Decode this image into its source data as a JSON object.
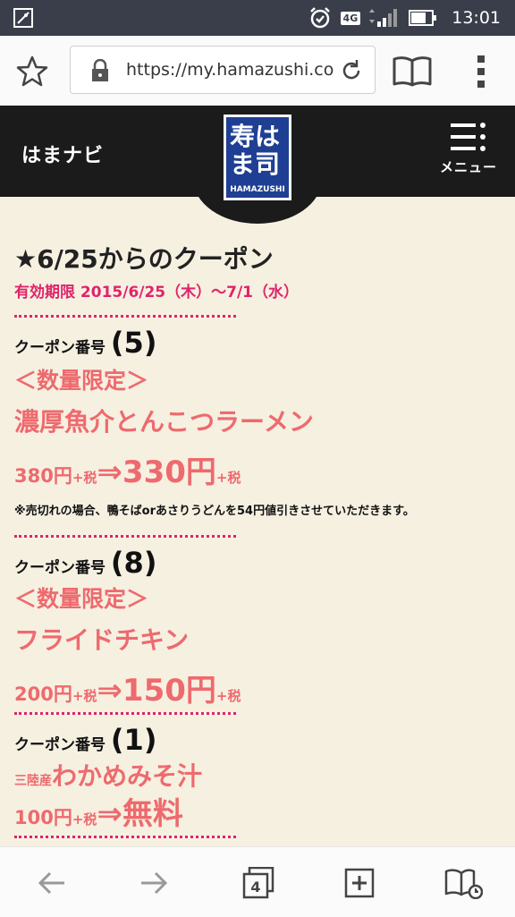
{
  "status_bar": {
    "time": "13:01",
    "network": "4G"
  },
  "browser": {
    "url": "https://my.hamazushi.co"
  },
  "site": {
    "title": "はまナビ",
    "menu_label": "メニュー",
    "logo_kanji": "寿はま司",
    "logo_text": "HAMAZUSHI"
  },
  "coupons_section": {
    "heading": "★6/25からのクーポン",
    "validity": "有効期限 2015/6/25（木）～7/1（水）"
  },
  "coupons": [
    {
      "label": "クーポン番号",
      "number": "(5)",
      "limited": "＜数量限定＞",
      "name": "濃厚魚介とんこつラーメン",
      "old_price": "380円",
      "tax": "+税",
      "arrow": "⇒",
      "new_price": "330円",
      "tax2": "+税",
      "note": "※売切れの場合、鴨そばorあさりうどんを54円値引きさせていただきます。"
    },
    {
      "label": "クーポン番号",
      "number": "(8)",
      "limited": "＜数量限定＞",
      "name": "フライドチキン",
      "old_price": "200円",
      "tax": "+税",
      "arrow": "⇒",
      "new_price": "150円",
      "tax2": "+税"
    },
    {
      "label": "クーポン番号",
      "number": "(1)",
      "prefix": "三陸産",
      "name": "わかめみそ汁",
      "old_price": "100円",
      "tax": "+税",
      "arrow": "⇒",
      "new_price": "無料"
    }
  ],
  "bottom_nav": {
    "tab_count": "4"
  },
  "colors": {
    "accent_pink": "#e0236a",
    "coupon_red": "#ee6a6e",
    "header_black": "#1b1b1b",
    "logo_blue": "#1e3f93"
  }
}
